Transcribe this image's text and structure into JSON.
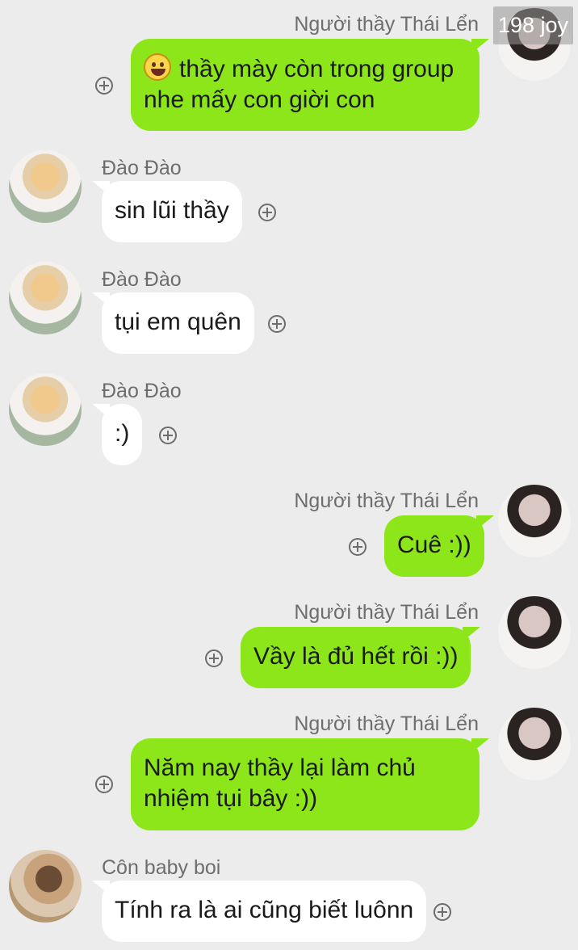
{
  "watermark": "198 joy",
  "messages": [
    {
      "sender": "Người thầy Thái Lển",
      "side": "right",
      "avatar": "teacher-avatar",
      "emoji": "grinning-face-emoji",
      "lines": [
        "thầy mày còn trong group",
        "nhe mấy con giời con"
      ]
    },
    {
      "sender": "Đào Đào",
      "side": "left",
      "avatar": "dao-dao-avatar",
      "lines": [
        "sin lũi thầy"
      ]
    },
    {
      "sender": "Đào Đào",
      "side": "left",
      "avatar": "dao-dao-avatar",
      "lines": [
        "tụi em quên"
      ]
    },
    {
      "sender": "Đào Đào",
      "side": "left",
      "avatar": "dao-dao-avatar",
      "lines": [
        ":)"
      ]
    },
    {
      "sender": "Người thầy Thái Lển",
      "side": "right",
      "avatar": "teacher-avatar",
      "lines": [
        "Cuê :))"
      ]
    },
    {
      "sender": "Người thầy Thái Lển",
      "side": "right",
      "avatar": "teacher-avatar",
      "lines": [
        "Vầy là đủ hết rồi :))"
      ]
    },
    {
      "sender": "Người thầy Thái Lển",
      "side": "right",
      "avatar": "teacher-avatar",
      "lines": [
        "Năm nay thầy lại làm chủ",
        "nhiệm tụi bây :))"
      ]
    },
    {
      "sender": "Côn baby boi",
      "side": "left",
      "avatar": "con-baby-boi-avatar",
      "lines": [
        "Tính ra là ai cũng biết luônn"
      ]
    }
  ],
  "colors": {
    "background": "#ececec",
    "outgoing_bubble": "#8de61a",
    "incoming_bubble": "#ffffff",
    "name_text": "#6d6d6d"
  }
}
